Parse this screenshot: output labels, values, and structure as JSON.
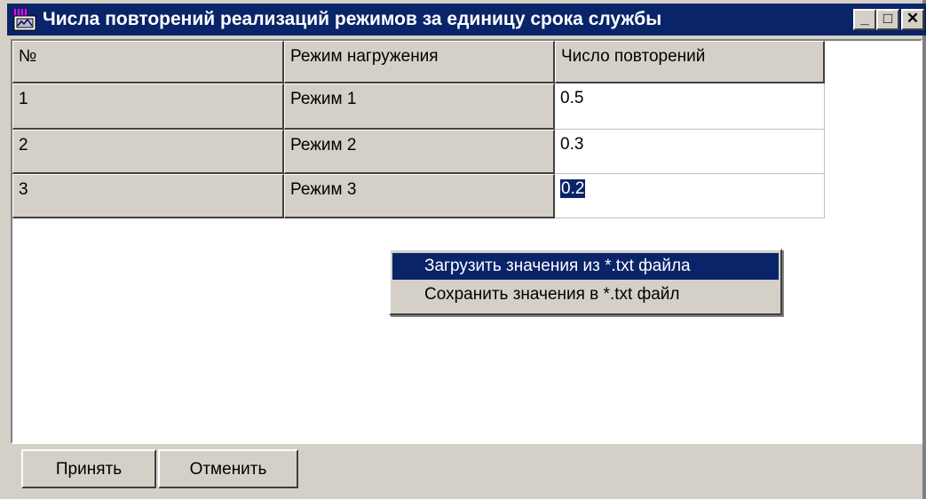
{
  "window": {
    "title": "Числа повторений реализаций режимов за единицу срока службы",
    "controls": {
      "minimize": "_",
      "maximize": "□",
      "close": "✕"
    }
  },
  "table": {
    "columns": [
      "№",
      "Режим нагружения",
      "Число повторений"
    ],
    "rows": [
      {
        "num": "1",
        "mode": "Режим 1",
        "value": "0.5"
      },
      {
        "num": "2",
        "mode": "Режим 2",
        "value": "0.3"
      },
      {
        "num": "3",
        "mode": "Режим 3",
        "value": "0.2"
      }
    ]
  },
  "context_menu": {
    "items": [
      "Загрузить значения из *.txt файла",
      "Сохранить значения в *.txt файл"
    ],
    "highlighted_index": 0
  },
  "buttons": {
    "accept": "Принять",
    "cancel": "Отменить"
  },
  "colors": {
    "face": "#d4d0c8",
    "title_bar": "#0a246a",
    "selection": "#0a246a"
  }
}
